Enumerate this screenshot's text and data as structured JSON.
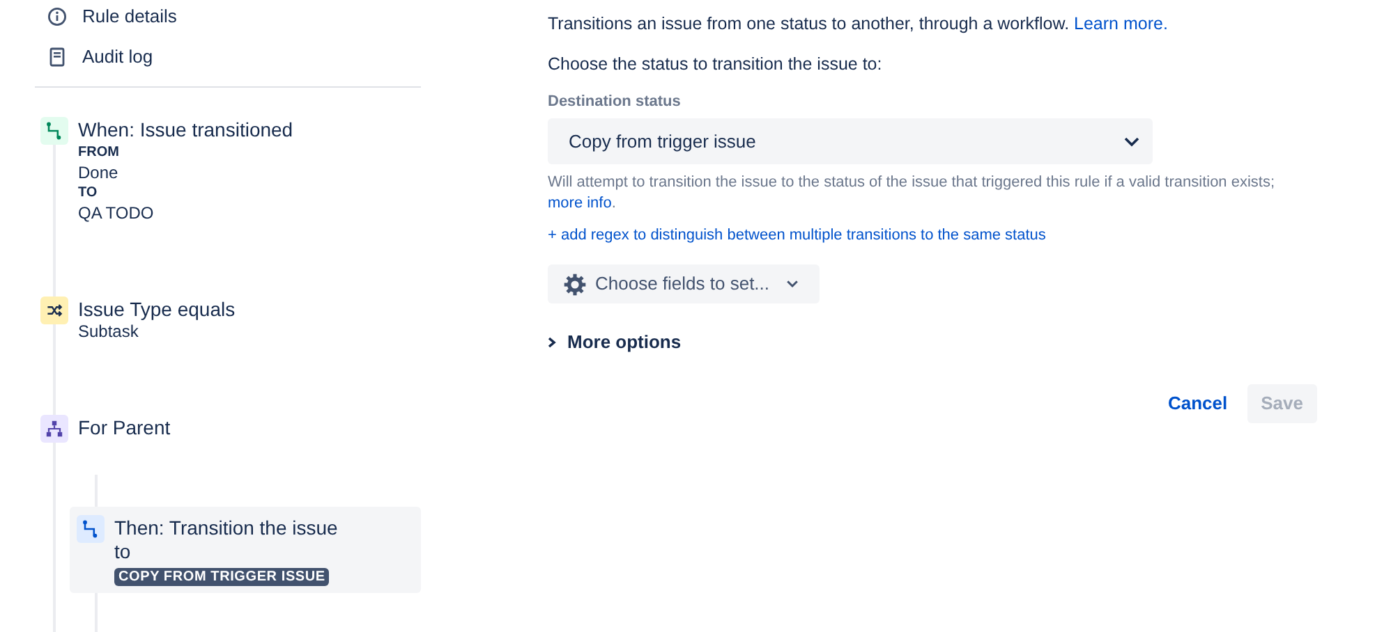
{
  "nav": [
    {
      "label": "Rule details",
      "kind": "info"
    },
    {
      "label": "Audit log",
      "kind": "log"
    }
  ],
  "steps": [
    {
      "kind": "trigger",
      "title": "When: Issue transitioned",
      "selected": false,
      "details": [
        {
          "text": "FROM",
          "bold": true
        },
        {
          "text": "Done",
          "bold": false
        },
        {
          "text": "TO",
          "bold": true
        },
        {
          "text": "QA TODO",
          "bold": false
        }
      ]
    },
    {
      "kind": "condition",
      "title": "Issue Type equals",
      "selected": false,
      "details": [
        {
          "text": "Subtask",
          "bold": false
        }
      ]
    },
    {
      "kind": "branch",
      "title": "For Parent",
      "selected": false,
      "children": [
        {
          "kind": "action",
          "title": "Then: Transition the issue to",
          "selected": true,
          "badge": "COPY FROM TRIGGER ISSUE"
        }
      ]
    }
  ],
  "panel": {
    "intro": "Transitions an issue from one status to another, through a workflow.",
    "intro_link": "Learn more.",
    "prompt": "Choose the status to transition the issue to:",
    "field_label": "Destination status",
    "field_value": "Copy from trigger issue",
    "help": "Will attempt to transition the issue to the status of the issue that triggered this rule if a valid transition exists;",
    "help_link": "more info",
    "help_end": ".",
    "regex_link": "+ add regex to distinguish between multiple transitions to the same status",
    "fields_button": "Choose fields to set...",
    "more_options": {
      "label": "More options",
      "expanded": false
    },
    "cancel": "Cancel",
    "save": {
      "label": "Save",
      "disabled": true
    }
  }
}
